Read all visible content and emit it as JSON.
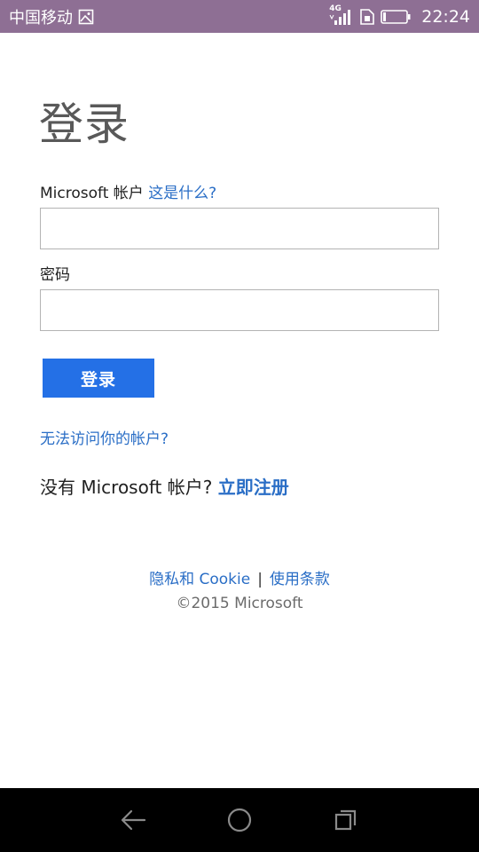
{
  "status_bar": {
    "carrier": "中国移动",
    "network": "4G",
    "time": "22:24"
  },
  "login": {
    "title": "登录",
    "account_label": "Microsoft 帐户",
    "whats_this": "这是什么?",
    "account_input_value": "",
    "password_label": "密码",
    "password_input_value": "",
    "signin_button": "登录",
    "cant_access": "无法访问你的帐户?",
    "no_account_text": "没有 Microsoft 帐户?",
    "signup_link": "立即注册"
  },
  "footer": {
    "privacy_link": "隐私和 Cookie",
    "separator": "|",
    "terms_link": "使用条款",
    "copyright": "©2015 Microsoft"
  },
  "colors": {
    "status_bar_bg": "#8e6f94",
    "link": "#2a6ec6",
    "button": "#2470e6",
    "nav_bar": "#000000"
  }
}
